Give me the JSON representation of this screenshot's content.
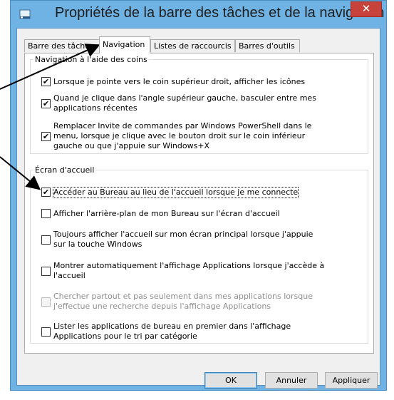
{
  "window": {
    "title": "Propriétés de la barre des tâches et de la navigation",
    "close_label": "✕"
  },
  "tabs": [
    {
      "label": "Barre des tâches",
      "active": false
    },
    {
      "label": "Navigation",
      "active": true
    },
    {
      "label": "Listes de raccourcis",
      "active": false
    },
    {
      "label": "Barres d'outils",
      "active": false
    }
  ],
  "navigation_group": {
    "legend": "Navigation à l'aide des coins",
    "options": [
      {
        "label": "Lorsque je pointe vers le coin supérieur droit, afficher les icônes",
        "checked": true,
        "enabled": true
      },
      {
        "label_lines": [
          "Quand je clique dans l'angle supérieur gauche, basculer entre mes",
          "applications récentes"
        ],
        "checked": true,
        "enabled": true
      },
      {
        "label_lines": [
          "Remplacer Invite de commandes par Windows PowerShell dans le",
          "menu, lorsque je clique avec le bouton droit sur le coin inférieur",
          "gauche ou que j'appuie sur Windows+X"
        ],
        "checked": true,
        "enabled": true
      }
    ]
  },
  "start_group": {
    "legend": "Écran d'accueil",
    "options": [
      {
        "label": "Accéder au Bureau au lieu de l'accueil lorsque je me connecte",
        "checked": true,
        "enabled": true,
        "focused": true
      },
      {
        "label": "Afficher l'arrière-plan de mon Bureau sur l'écran d'accueil",
        "checked": false,
        "enabled": true
      },
      {
        "label_lines": [
          "Toujours afficher l'accueil sur mon écran principal lorsque j'appuie",
          "sur la touche Windows"
        ],
        "checked": false,
        "enabled": true
      },
      {
        "label_lines": [
          "Montrer automatiquement l'affichage Applications lorsque j'accède à",
          "l'accueil"
        ],
        "checked": false,
        "enabled": true
      },
      {
        "label_lines": [
          "Chercher partout et pas seulement dans mes applications lorsque",
          "j'effectue une recherche depuis l'affichage Applications"
        ],
        "checked": false,
        "enabled": false
      },
      {
        "label_lines": [
          "Lister les applications de bureau en premier dans l'affichage",
          "Applications pour le tri par catégorie"
        ],
        "checked": false,
        "enabled": true
      }
    ]
  },
  "buttons": {
    "ok": "OK",
    "cancel": "Annuler",
    "apply": "Appliquer"
  },
  "check_glyph": "✔",
  "colors": {
    "title_bar": "#6fb3e4",
    "close_button": "#c7423a"
  }
}
